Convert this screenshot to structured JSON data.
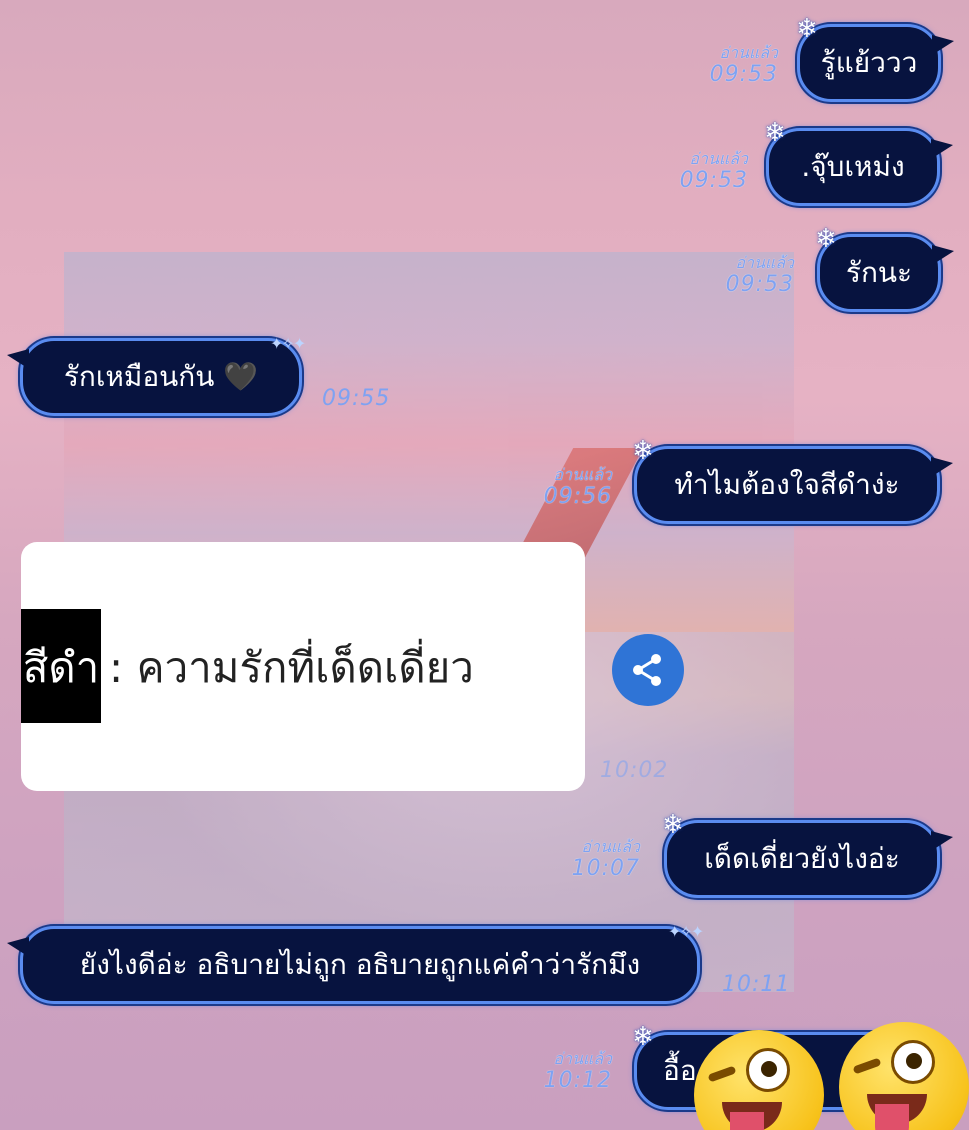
{
  "chat": {
    "read_label": "อ่านแล้ว",
    "messages": [
      {
        "side": "right",
        "text": "รู้แย้ววว",
        "read": "อ่านแล้ว",
        "time": "09:53"
      },
      {
        "side": "right",
        "text": ".จุ๊บเหม่ง",
        "read": "อ่านแล้ว",
        "time": "09:53"
      },
      {
        "side": "right",
        "text": "รักนะ",
        "read": "อ่านแล้ว",
        "time": "09:53"
      },
      {
        "side": "left",
        "text": "รักเหมือนกัน 🖤",
        "time": "09:55"
      },
      {
        "side": "right",
        "text": "ทำไมต้องใจสีดำง่ะ",
        "read": "อ่านแล้ว",
        "time": "09:56"
      },
      {
        "side": "left",
        "text": "ยังไงดีอ่ะ อธิบายไม่ถูก อธิบายถูกแค่คำว่ารักมึง",
        "time": "10:11"
      },
      {
        "side": "right",
        "text": "เด็ดเดี่ยวยังไงอ่ะ",
        "read": "อ่านแล้ว",
        "time": "10:07"
      },
      {
        "side": "right",
        "text": "อื้อ ก็รัก",
        "read": "อ่านแล้ว",
        "time": "10:12"
      }
    ],
    "image_card": {
      "highlight": "สีดำ",
      "text": " : ความรักที่เด็ดเดี่ยว",
      "time": "10:02"
    },
    "icons": {
      "share": "share-icon",
      "snowflake": "snowflake-icon",
      "emoji": "zany-face-emoji",
      "heart": "black-heart"
    },
    "colors": {
      "bubble_bg": "#07133f",
      "bubble_border": "#5a8cf0",
      "meta_text": "#7ea2f2",
      "share_bg": "#2f74d6"
    }
  }
}
